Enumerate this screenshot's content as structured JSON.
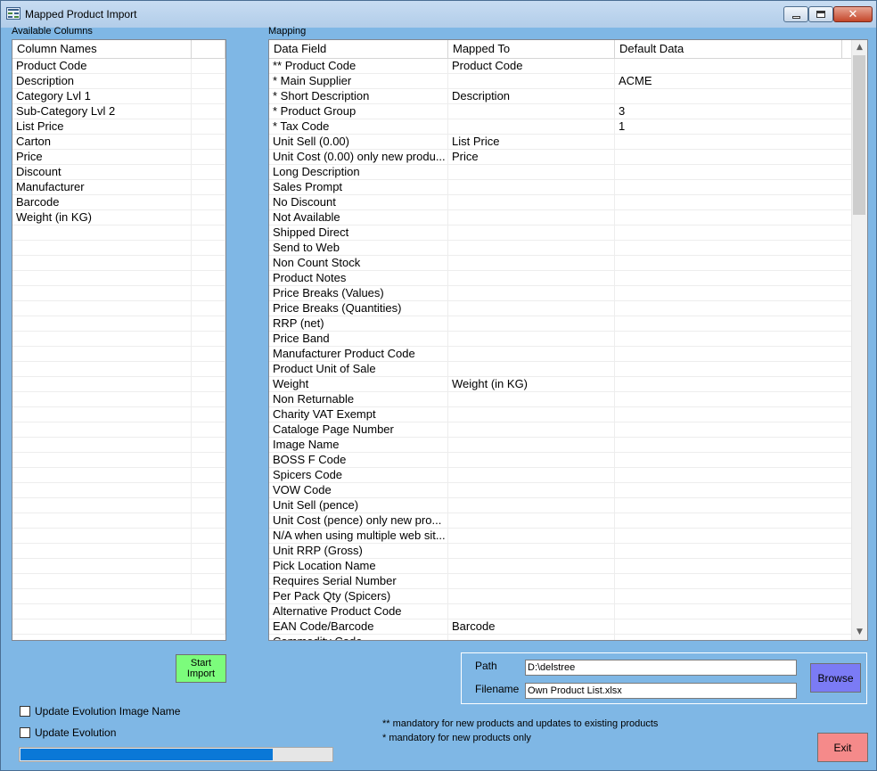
{
  "window": {
    "title": "Mapped Product Import",
    "controls": [
      "minimize",
      "maximize",
      "close"
    ]
  },
  "available_columns": {
    "label": "Available Columns",
    "header": "Column Names",
    "rows": [
      "Product Code",
      "Description",
      "Category Lvl 1",
      "Sub-Category Lvl 2",
      "List Price",
      "Carton",
      "Price",
      "Discount",
      "Manufacturer",
      "Barcode",
      "Weight (in KG)"
    ]
  },
  "mapping": {
    "label": "Mapping",
    "headers": [
      "Data Field",
      "Mapped To",
      "Default Data"
    ],
    "rows": [
      [
        "** Product Code",
        "Product Code",
        ""
      ],
      [
        "*  Main Supplier",
        "",
        "ACME"
      ],
      [
        "*  Short Description",
        "Description",
        ""
      ],
      [
        "*  Product Group",
        "",
        "3"
      ],
      [
        "*  Tax Code",
        "",
        "1"
      ],
      [
        "Unit Sell (0.00)",
        "List Price",
        ""
      ],
      [
        "Unit Cost (0.00) only new produ...",
        "Price",
        ""
      ],
      [
        "Long Description",
        "",
        ""
      ],
      [
        "Sales Prompt",
        "",
        ""
      ],
      [
        "No Discount",
        "",
        ""
      ],
      [
        "Not Available",
        "",
        ""
      ],
      [
        "Shipped Direct",
        "",
        ""
      ],
      [
        "Send to Web",
        "",
        ""
      ],
      [
        "Non Count Stock",
        "",
        ""
      ],
      [
        "Product Notes",
        "",
        ""
      ],
      [
        "Price Breaks (Values)",
        "",
        ""
      ],
      [
        "Price Breaks (Quantities)",
        "",
        ""
      ],
      [
        "RRP (net)",
        "",
        ""
      ],
      [
        "Price Band",
        "",
        ""
      ],
      [
        "Manufacturer Product Code",
        "",
        ""
      ],
      [
        "Product Unit of Sale",
        "",
        ""
      ],
      [
        "Weight",
        "Weight (in KG)",
        ""
      ],
      [
        "Non Returnable",
        "",
        ""
      ],
      [
        "Charity VAT Exempt",
        "",
        ""
      ],
      [
        "Cataloge Page Number",
        "",
        ""
      ],
      [
        "Image Name",
        "",
        ""
      ],
      [
        "BOSS F Code",
        "",
        ""
      ],
      [
        "Spicers Code",
        "",
        ""
      ],
      [
        "VOW Code",
        "",
        ""
      ],
      [
        "Unit Sell (pence)",
        "",
        ""
      ],
      [
        "Unit Cost (pence)  only new pro...",
        "",
        ""
      ],
      [
        "N/A when using multiple web sit...",
        "",
        ""
      ],
      [
        "Unit RRP (Gross)",
        "",
        ""
      ],
      [
        "Pick Location Name",
        "",
        ""
      ],
      [
        "Requires Serial Number",
        "",
        ""
      ],
      [
        "Per Pack Qty (Spicers)",
        "",
        ""
      ],
      [
        "Alternative Product Code",
        "",
        ""
      ],
      [
        "EAN Code/Barcode",
        "Barcode",
        ""
      ],
      [
        "Commodity Code",
        "",
        ""
      ]
    ],
    "scroll_fraction": 0.28
  },
  "start_import": {
    "label_line1": "Start",
    "label_line2": "Import"
  },
  "file": {
    "path_label": "Path",
    "path_value": "D:\\delstree",
    "filename_label": "Filename",
    "filename_value": "Own Product List.xlsx",
    "browse_label": "Browse"
  },
  "options": {
    "update_image_name": "Update Evolution Image Name",
    "update_evolution": "Update Evolution"
  },
  "progress": {
    "fraction": 0.81
  },
  "notes": {
    "mandatory_all": "**  mandatory for new products and updates to existing products",
    "mandatory_new": "*   mandatory for new products only"
  },
  "exit_label": "Exit",
  "colors": {
    "window_bg": "#7fb7e5",
    "start_button": "#7cfc7c",
    "browse_button": "#7b7bf5",
    "exit_button": "#f58a8a",
    "progress_fill": "#0a78d7"
  }
}
